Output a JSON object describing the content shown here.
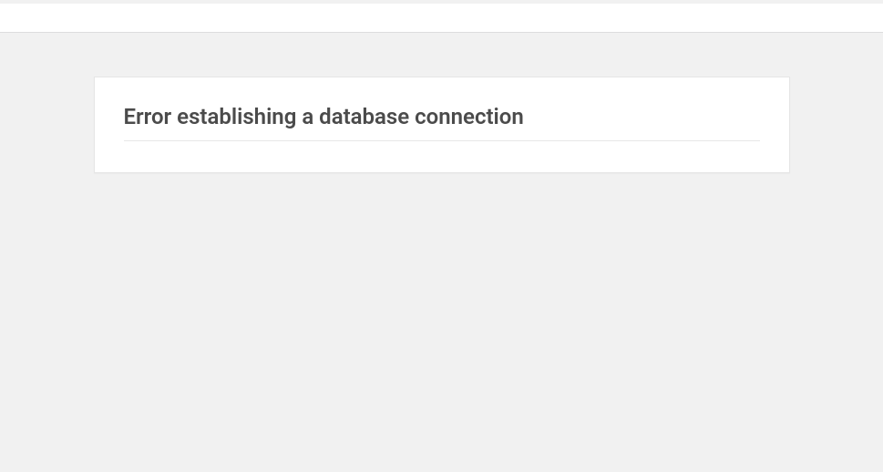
{
  "error": {
    "heading": "Error establishing a database connection"
  }
}
